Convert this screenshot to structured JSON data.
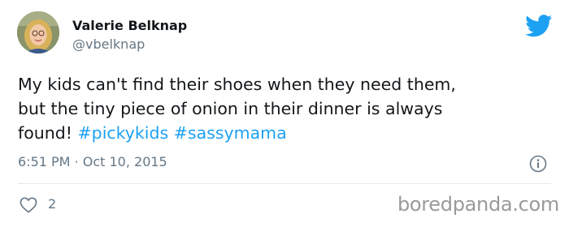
{
  "user": {
    "display_name": "Valerie Belknap",
    "handle": "@vbelknap"
  },
  "tweet": {
    "line1": "My kids can't find their shoes when they need them,",
    "line2": "but the tiny piece of onion in their dinner is always",
    "line3_prefix": "found! ",
    "hashtags": [
      "#pickykids",
      "#sassymama"
    ],
    "timestamp": "6:51 PM · Oct 10, 2015",
    "like_count": "2"
  },
  "icons": {
    "brand": "twitter-bird-icon",
    "info": "info-icon",
    "like": "heart-icon"
  },
  "watermark": "boredpanda.com",
  "colors": {
    "link": "#1da1f2",
    "secondary_text": "#657786",
    "primary_text": "#14171a"
  }
}
